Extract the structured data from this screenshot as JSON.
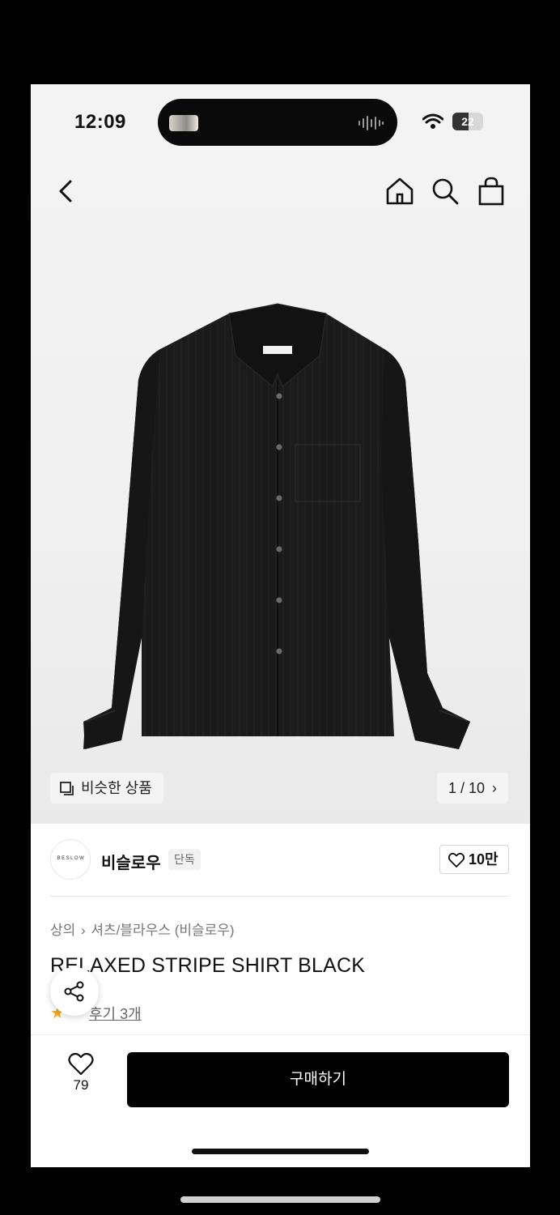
{
  "status_bar": {
    "time": "12:09",
    "battery": "22"
  },
  "header": {
    "back_icon": "chevron-left-icon",
    "home_icon": "home-icon",
    "search_icon": "search-icon",
    "bag_icon": "shopping-bag-icon"
  },
  "gallery": {
    "similar_label": "비슷한 상품",
    "page_indicator": "1 / 10"
  },
  "brand": {
    "logo_text": "BESLOW",
    "name": "비슬로우",
    "badge": "단독",
    "likes": "10만"
  },
  "product": {
    "breadcrumb": [
      "상의",
      "셔츠/블라우스 (비슬로우)"
    ],
    "title": "RELAXED STRIPE SHIRT BLACK",
    "reviews": "후기 3개"
  },
  "bottom_bar": {
    "wish_count": "79",
    "buy_label": "구매하기"
  },
  "colors": {
    "accent": "#000000",
    "star": "#f5a623"
  }
}
